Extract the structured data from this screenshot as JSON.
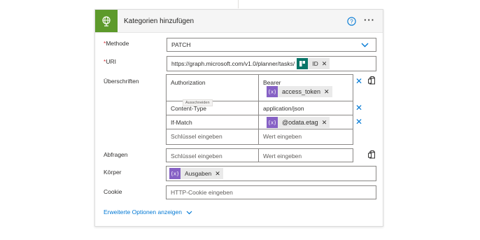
{
  "header": {
    "title": "Kategorien hinzufügen",
    "icon": "globe-icon",
    "accent": "#5d9a2b"
  },
  "method": {
    "label": "Methode",
    "required_mark": "*",
    "value": "PATCH"
  },
  "uri": {
    "label": "URI",
    "required_mark": "*",
    "value": "https://graph.microsoft.com/v1.0/planner/tasks/",
    "token_label": "ID"
  },
  "headers": {
    "label": "Überschriften",
    "rows": [
      {
        "key": "Authorization",
        "value_text": "Bearer",
        "value_token": "access_token"
      },
      {
        "key": "Content-Type",
        "value_text": "application/json"
      },
      {
        "key": "If-Match",
        "value_token": "@odata.etag"
      }
    ],
    "key_placeholder": "Schlüssel eingeben",
    "value_placeholder": "Wert eingeben",
    "tooltip": "Ausschneiden"
  },
  "queries": {
    "label": "Abfragen",
    "key_placeholder": "Schlüssel eingeben",
    "value_placeholder": "Wert eingeben"
  },
  "body": {
    "label": "Körper",
    "token_label": "Ausgaben"
  },
  "cookie": {
    "label": "Cookie",
    "placeholder": "HTTP-Cookie eingeben"
  },
  "advanced": {
    "label": "Erweiterte Optionen anzeigen"
  }
}
